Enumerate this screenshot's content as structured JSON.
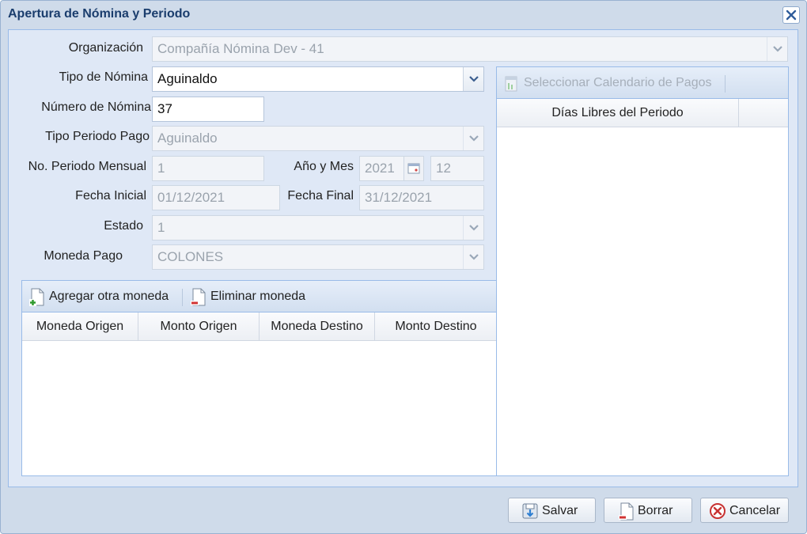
{
  "window": {
    "title": "Apertura de Nómina y Periodo"
  },
  "form": {
    "organizacion": {
      "label": "Organización",
      "value": "Compañía Nómina Dev - 41"
    },
    "tipo_nomina": {
      "label": "Tipo de Nómina",
      "value": "Aguinaldo"
    },
    "numero_nomina": {
      "label": "Número de Nómina",
      "value": "37"
    },
    "tipo_periodo_pago": {
      "label": "Tipo Periodo Pago",
      "value": "Aguinaldo"
    },
    "no_periodo_mensual": {
      "label": "No. Periodo Mensual",
      "value": "1"
    },
    "anio_mes": {
      "label": "Año y Mes",
      "year": "2021",
      "month": "12"
    },
    "fecha_inicial": {
      "label": "Fecha Inicial",
      "value": "01/12/2021"
    },
    "fecha_final": {
      "label": "Fecha Final",
      "value": "31/12/2021"
    },
    "estado": {
      "label": "Estado",
      "value": "1"
    },
    "moneda_pago": {
      "label": "Moneda Pago",
      "value": "COLONES"
    }
  },
  "currency_panel": {
    "add_label": "Agregar otra moneda",
    "remove_label": "Eliminar moneda",
    "columns": [
      "Moneda Origen",
      "Monto Origen",
      "Moneda Destino",
      "Monto Destino"
    ],
    "rows": []
  },
  "calendar_panel": {
    "select_label": "Seleccionar Calendario de Pagos",
    "columns": [
      "Días Libres del Periodo"
    ],
    "rows": []
  },
  "buttons": {
    "save": "Salvar",
    "clear": "Borrar",
    "cancel": "Cancelar"
  }
}
